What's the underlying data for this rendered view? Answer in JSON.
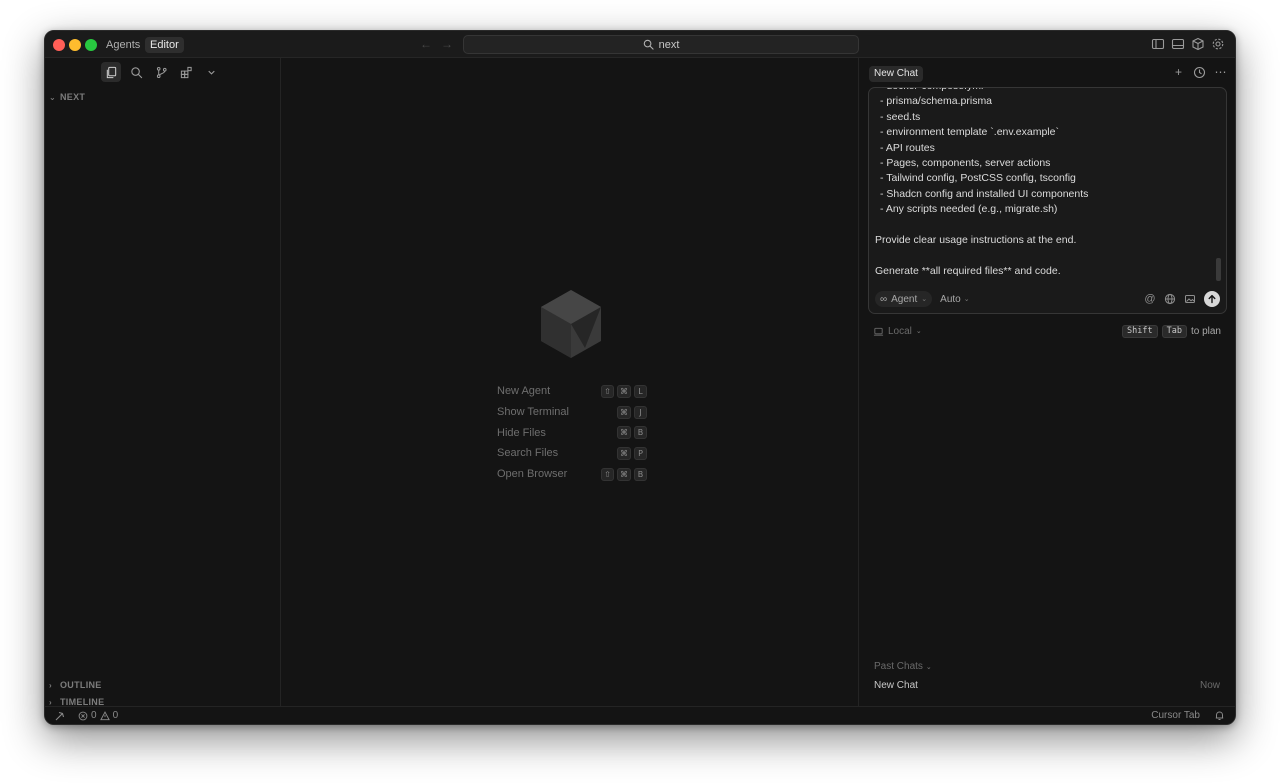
{
  "titlebar": {
    "modes": [
      {
        "label": "Agents",
        "active": false
      },
      {
        "label": "Editor",
        "active": true
      }
    ],
    "search_text": "next"
  },
  "sidebar": {
    "folder_name": "NEXT",
    "sections": [
      {
        "label": "OUTLINE"
      },
      {
        "label": "TIMELINE"
      }
    ]
  },
  "center": {
    "shortcuts": [
      {
        "label": "New Agent",
        "keys": [
          "⇧",
          "⌘",
          "L"
        ]
      },
      {
        "label": "Show Terminal",
        "keys": [
          "⌘",
          "J"
        ]
      },
      {
        "label": "Hide Files",
        "keys": [
          "⌘",
          "B"
        ]
      },
      {
        "label": "Search Files",
        "keys": [
          "⌘",
          "P"
        ]
      },
      {
        "label": "Open Browser",
        "keys": [
          "⇧",
          "⌘",
          "B"
        ]
      }
    ]
  },
  "chat": {
    "tab_label": "New Chat",
    "composer_lines": [
      {
        "text": "- docker-compose.yml",
        "bullet": true
      },
      {
        "text": "- prisma/schema.prisma",
        "bullet": true
      },
      {
        "text": "- seed.ts",
        "bullet": true
      },
      {
        "text": "- environment template `.env.example`",
        "bullet": true
      },
      {
        "text": "- API routes",
        "bullet": true
      },
      {
        "text": "- Pages, components, server actions",
        "bullet": true
      },
      {
        "text": "- Tailwind config, PostCSS config, tsconfig",
        "bullet": true
      },
      {
        "text": "- Shadcn config and installed UI components",
        "bullet": true
      },
      {
        "text": "- Any scripts needed (e.g., migrate.sh)",
        "bullet": true
      },
      {
        "text": "",
        "bullet": false
      },
      {
        "text": "Provide clear usage instructions at the end.",
        "bullet": false
      },
      {
        "text": "",
        "bullet": false
      },
      {
        "text": "Generate **all required files** and code.",
        "bullet": false
      }
    ],
    "agent_label": "Agent",
    "model_label": "Auto",
    "environment_label": "Local",
    "plan_keys": [
      "Shift",
      "Tab"
    ],
    "plan_hint": "to plan",
    "past_chats_label": "Past Chats",
    "past_chats": [
      {
        "title": "New Chat",
        "time": "Now"
      }
    ]
  },
  "statusbar": {
    "errors": "0",
    "warnings": "0",
    "right_label": "Cursor Tab"
  },
  "colors": {
    "window_bg": "#141414",
    "titlebar_bg": "#1b1b1b",
    "close": "#ff5f57",
    "minimize": "#febc2e",
    "maximize": "#28c840"
  }
}
